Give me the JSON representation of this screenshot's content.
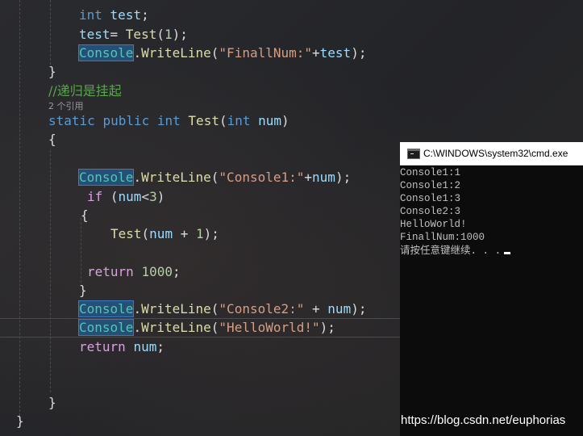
{
  "editor": {
    "line1": {
      "kw": "int",
      "var": "test",
      "semi": ";"
    },
    "line2": {
      "var": "test",
      "eq": "= ",
      "fn": "Test",
      "open": "(",
      "num": "1",
      "close": ");"
    },
    "line3": {
      "cls": "Console",
      "dot": ".",
      "fn": "WriteLine",
      "open": "(",
      "str": "\"FinallNum:\"",
      "plus": "+",
      "var": "test",
      "close": ");"
    },
    "line4": {
      "brace": "}"
    },
    "comment": "//递归是挂起",
    "codelens": "2 个引用",
    "method_sig": {
      "kw1": "static",
      "kw2": "public",
      "kw3": "int",
      "fn": "Test",
      "open": "(",
      "kw4": "int",
      "param": "num",
      "close": ")"
    },
    "open_brace": "{",
    "line_c1": {
      "cls": "Console",
      "dot": ".",
      "fn": "WriteLine",
      "open": "(",
      "str": "\"Console1:\"",
      "plus": "+",
      "var": "num",
      "close": ");"
    },
    "line_if": {
      "kw": "if",
      "open": " (",
      "var": "num",
      "op": "<",
      "num": "3",
      "close": ")"
    },
    "if_open": "{",
    "line_rec": {
      "fn": "Test",
      "open": "(",
      "var": "num",
      "op": " + ",
      "num": "1",
      "close": ");"
    },
    "line_ret1": {
      "kw": "return",
      "num": "1000",
      "semi": ";"
    },
    "if_close": "}",
    "line_c2": {
      "cls": "Console",
      "dot": ".",
      "fn": "WriteLine",
      "open": "(",
      "str": "\"Console2:\"",
      "plus": " + ",
      "var": "num",
      "close": ");"
    },
    "line_hw": {
      "cls": "Console",
      "dot": ".",
      "fn": "WriteLine",
      "open": "(",
      "str": "\"HelloWorld!\"",
      "close": ");"
    },
    "line_ret2": {
      "kw": "return",
      "var": "num",
      "semi": ";"
    },
    "method_close": "}",
    "class_close": "}"
  },
  "cmd": {
    "title": "C:\\WINDOWS\\system32\\cmd.exe",
    "lines": [
      "Console1:1",
      "Console1:2",
      "Console1:3",
      "Console2:3",
      "HelloWorld!",
      "FinallNum:1000",
      "请按任意键继续. . ."
    ]
  },
  "watermark": "https://blog.csdn.net/euphorias",
  "colors": {
    "keyword": "#569cd6",
    "type": "#4ec9b0",
    "method": "#dcdcaa",
    "string": "#d69d85",
    "number": "#b5cea8",
    "variable": "#9cdcfe",
    "comment": "#57a64a",
    "control": "#d8a0df",
    "selection": "#264f78",
    "console_bg": "#0c0c0c"
  }
}
